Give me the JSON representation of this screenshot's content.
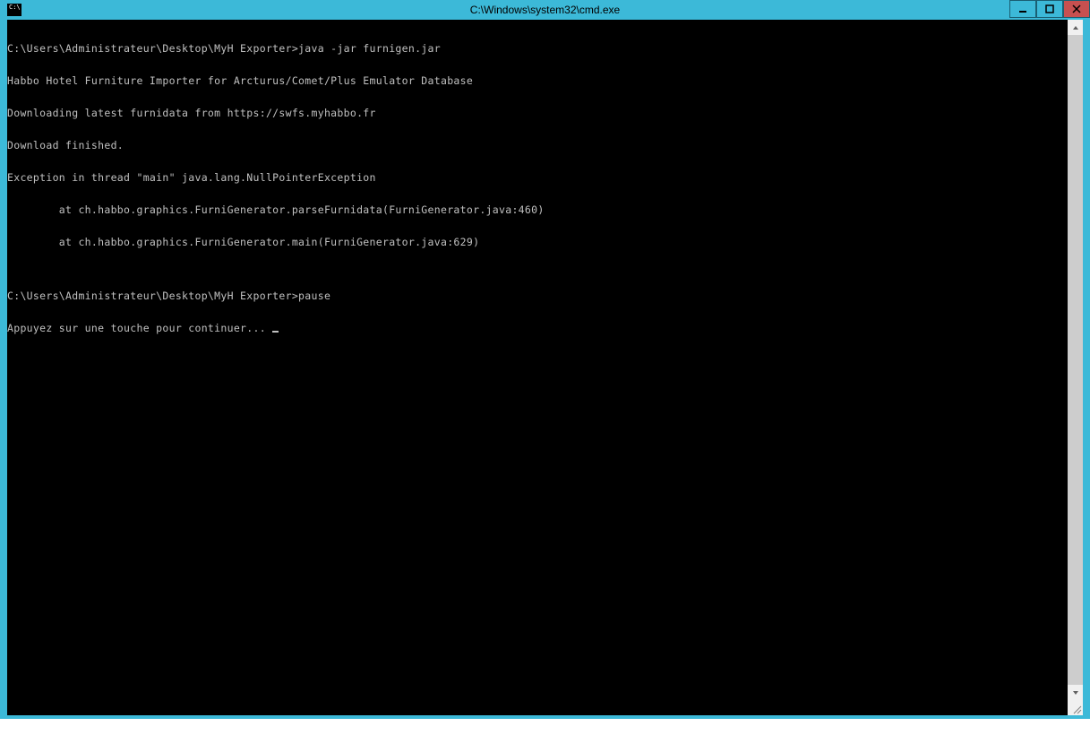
{
  "window": {
    "title": "C:\\Windows\\system32\\cmd.exe",
    "icon_label": "C:\\"
  },
  "console": {
    "lines": [
      "C:\\Users\\Administrateur\\Desktop\\MyH Exporter>java -jar furnigen.jar",
      "Habbo Hotel Furniture Importer for Arcturus/Comet/Plus Emulator Database",
      "Downloading latest furnidata from https://swfs.myhabbo.fr",
      "Download finished.",
      "Exception in thread \"main\" java.lang.NullPointerException",
      "        at ch.habbo.graphics.FurniGenerator.parseFurnidata(FurniGenerator.java:460)",
      "        at ch.habbo.graphics.FurniGenerator.main(FurniGenerator.java:629)",
      "",
      "C:\\Users\\Administrateur\\Desktop\\MyH Exporter>pause",
      "Appuyez sur une touche pour continuer... "
    ]
  },
  "colors": {
    "titlebar": "#3cb9d8",
    "console_bg": "#000000",
    "console_fg": "#c0c0c0",
    "close_btn": "#c75050"
  }
}
